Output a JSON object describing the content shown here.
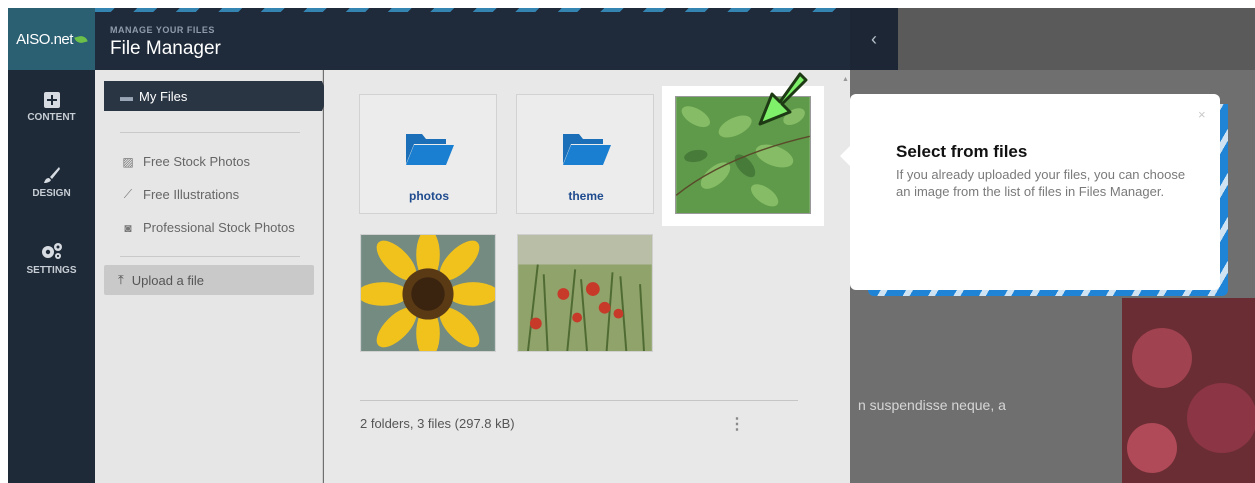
{
  "brand": {
    "logo_text": "AISO.net"
  },
  "rail": {
    "items": [
      {
        "label": "CONTENT",
        "icon": "plus-square-icon"
      },
      {
        "label": "DESIGN",
        "icon": "brush-icon"
      },
      {
        "label": "SETTINGS",
        "icon": "gears-icon"
      }
    ]
  },
  "file_manager": {
    "eyebrow": "MANAGE YOUR FILES",
    "title": "File Manager",
    "nav": {
      "my_files": "My Files",
      "free_stock_photos": "Free Stock Photos",
      "free_illustrations": "Free Illustrations",
      "professional_stock_photos": "Professional Stock Photos",
      "upload": "Upload a file"
    },
    "folders": [
      {
        "name": "photos"
      },
      {
        "name": "theme"
      }
    ],
    "status": "2 folders, 3 files (297.8 kB)"
  },
  "tooltip": {
    "title": "Select from files",
    "body": "If you already uploaded your files, you can choose an image from the list of files in Files Manager.",
    "close": "×"
  },
  "background": {
    "text": "n suspendisse neque, a"
  },
  "colors": {
    "rail_bg": "#1f2a38",
    "logo_bg": "#2b5f72",
    "accent_blue": "#1f84d6",
    "folder_blue": "#1a6fb8",
    "highlight_arrow": "#7ef06a"
  }
}
